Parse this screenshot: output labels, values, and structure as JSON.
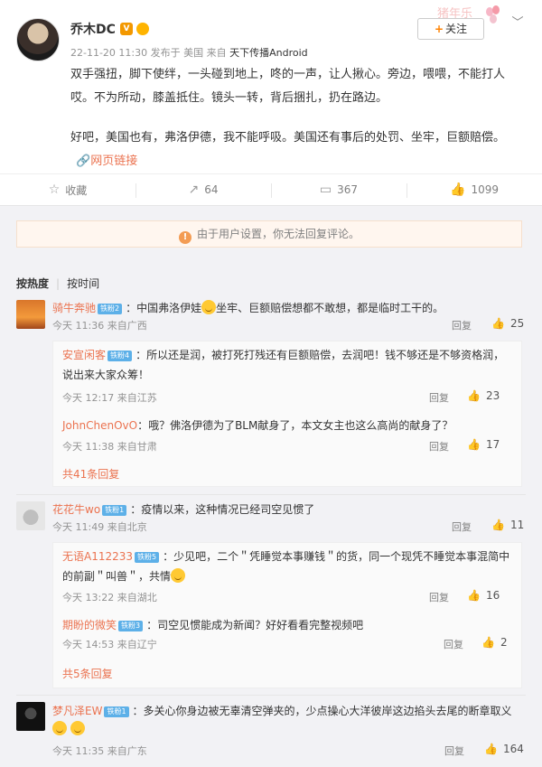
{
  "post": {
    "author": "乔木DC",
    "vip_badge": "V",
    "meta": "22-11-20 11:30 发布于 美国 来自",
    "source": "天下传播Android",
    "follow_label": "关注",
    "follow_plus": "+",
    "deco_text": "猪年乐",
    "paragraph1": "双手强扭，脚下使绊，一头碰到地上，咚的一声，让人揪心。旁边，喂喂，不能打人哎。不为所动，膝盖抵住。镜头一转，背后捆扎，扔在路边。",
    "paragraph2": "好吧，美国也有，弗洛伊德，我不能呼吸。美国还有事后的处罚、坐牢，巨额赔偿。",
    "web_link": "网页链接"
  },
  "actions": {
    "favorite": "收藏",
    "repost": "64",
    "comment": "367",
    "like": "1099"
  },
  "notice": "由于用户设置，你无法回复评论。",
  "sort": {
    "hot": "按热度",
    "time": "按时间"
  },
  "comments": [
    {
      "user": "骑牛奔驰",
      "badge": "铁粉2",
      "text_before": "：中国弗洛伊娃",
      "text_after": "坐牢、巨额赔偿想都不敢想，都是临时工干的。",
      "meta": "今天 11:36 来自广西",
      "reply": "回复",
      "likes": "25",
      "replies": [
        {
          "user": "安宣闲客",
          "badge": "铁粉4",
          "text": "：所以还是润，被打死打残还有巨额赔偿，去润吧！钱不够还是不够资格润，说出来大家众筹！",
          "meta": "今天 12:17 来自江苏",
          "reply": "回复",
          "likes": "23"
        },
        {
          "user": "JohnChenOvO",
          "text": "：哦？佛洛伊德为了BLM献身了，本文女主也这么高尚的献身了？",
          "meta": "今天 11:38 来自甘肃",
          "reply": "回复",
          "likes": "17"
        }
      ],
      "more": "共41条回复"
    },
    {
      "user": "花花牛wo",
      "badge": "铁粉1",
      "text": "：疫情以来，这种情况已经司空见惯了",
      "meta": "今天 11:49 来自北京",
      "reply": "回复",
      "likes": "11",
      "replies": [
        {
          "user": "无语A112233",
          "badge": "铁粉5",
          "text": "：少见吧，二个＂凭睡觉本事赚钱＂的货，同一个现凭不睡觉本事混简中的前副＂叫兽＂，共情",
          "meta": "今天 13:22 来自湖北",
          "reply": "回复",
          "likes": "16"
        },
        {
          "user": "期盼的微笑",
          "badge": "铁粉3",
          "text": "：司空见惯能成为新闻？好好看看完整视频吧",
          "meta": "今天 14:53 来自辽宁",
          "reply": "回复",
          "likes": "2"
        }
      ],
      "more": "共5条回复"
    },
    {
      "user": "梦凡泽EW",
      "badge": "铁粉1",
      "text": "：多关心你身边被无辜清空弹夹的，少点操心大洋彼岸这边掐头去尾的断章取义",
      "meta": "今天 11:35 来自广东",
      "reply": "回复",
      "likes": "164"
    }
  ]
}
